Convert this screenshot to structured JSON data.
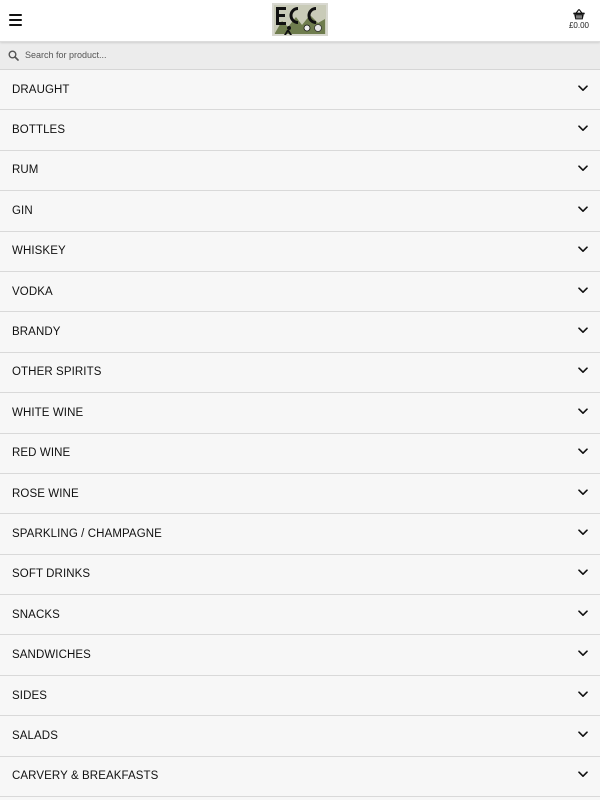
{
  "header": {
    "menu_icon": "hamburger-menu-icon",
    "logo_alt": "ECC logo",
    "cart_icon": "shopping-basket-icon",
    "cart_total": "£0.00"
  },
  "search": {
    "placeholder": "Search for product...",
    "value": "",
    "icon": "search-icon"
  },
  "categories": [
    {
      "label": "DRAUGHT"
    },
    {
      "label": "BOTTLES"
    },
    {
      "label": "RUM"
    },
    {
      "label": "GIN"
    },
    {
      "label": "WHISKEY"
    },
    {
      "label": "VODKA"
    },
    {
      "label": "BRANDY"
    },
    {
      "label": "OTHER SPIRITS"
    },
    {
      "label": "WHITE WINE"
    },
    {
      "label": "RED WINE"
    },
    {
      "label": "ROSE WINE"
    },
    {
      "label": "SPARKLING / CHAMPAGNE"
    },
    {
      "label": "SOFT DRINKS"
    },
    {
      "label": "SNACKS"
    },
    {
      "label": "SANDWICHES"
    },
    {
      "label": "SIDES"
    },
    {
      "label": "SALADS"
    },
    {
      "label": "CARVERY & BREAKFASTS"
    }
  ],
  "colors": {
    "header_bg": "#ffffff",
    "search_bg": "#ececec",
    "list_bg": "#f7f7f7",
    "divider": "#d9d9d9",
    "text": "#111111"
  }
}
